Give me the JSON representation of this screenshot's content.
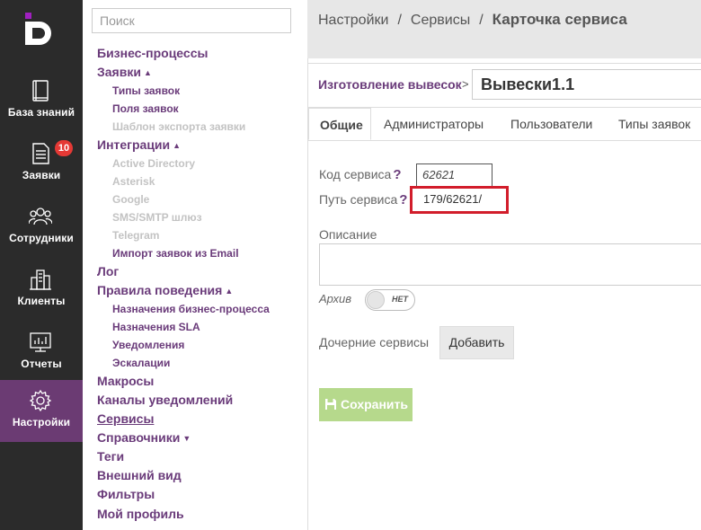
{
  "rail": {
    "items": [
      {
        "label": "База знаний",
        "icon": "book-icon"
      },
      {
        "label": "Заявки",
        "icon": "document-icon",
        "badge": "10"
      },
      {
        "label": "Сотрудники",
        "icon": "people-icon"
      },
      {
        "label": "Клиенты",
        "icon": "buildings-icon"
      },
      {
        "label": "Отчеты",
        "icon": "chart-monitor-icon"
      },
      {
        "label": "Настройки",
        "icon": "gear-icon"
      }
    ],
    "active_index": 5
  },
  "menu": {
    "search_placeholder": "Поиск",
    "items": [
      {
        "label": "Бизнес-процессы"
      },
      {
        "label": "Заявки",
        "expanded": true
      },
      {
        "label": "Типы заявок"
      },
      {
        "label": "Поля заявок"
      },
      {
        "label": "Шаблон экспорта заявки",
        "disabled": true
      },
      {
        "label": "Интеграции",
        "expanded": true
      },
      {
        "label": "Active Directory",
        "disabled": true
      },
      {
        "label": "Asterisk",
        "disabled": true
      },
      {
        "label": "Google",
        "disabled": true
      },
      {
        "label": "SMS/SMTP шлюз",
        "disabled": true
      },
      {
        "label": "Telegram",
        "disabled": true
      },
      {
        "label": "Импорт заявок из Email"
      },
      {
        "label": "Лог"
      },
      {
        "label": "Правила поведения",
        "expanded": true
      },
      {
        "label": "Назначения бизнес-процесса"
      },
      {
        "label": "Назначения SLA"
      },
      {
        "label": "Уведомления"
      },
      {
        "label": "Эскалации"
      },
      {
        "label": "Макросы"
      },
      {
        "label": "Каналы уведомлений"
      },
      {
        "label": "Сервисы",
        "current": true
      },
      {
        "label": "Справочники",
        "expanded": false
      },
      {
        "label": "Теги"
      },
      {
        "label": "Внешний вид"
      },
      {
        "label": "Фильтры"
      },
      {
        "label": "Мой профиль"
      }
    ]
  },
  "breadcrumb": {
    "items": [
      "Настройки",
      "Сервисы",
      "Карточка сервиса"
    ],
    "separator": "/"
  },
  "service": {
    "parent_link": "Изготовление вывесок",
    "chevron": ">",
    "title": "Вывески1.1"
  },
  "tabs": [
    {
      "label": "Общие",
      "active": true
    },
    {
      "label": "Администраторы"
    },
    {
      "label": "Пользователи"
    },
    {
      "label": "Типы заявок"
    }
  ],
  "form": {
    "code_label": "Код сервиса",
    "code_value": "62621",
    "path_label": "Путь сервиса",
    "path_value": "179/62621/",
    "help_mark": "?",
    "description_label": "Описание",
    "description_value": "",
    "archive_label": "Архив",
    "archive_toggle_text": "НЕТ",
    "archive_on": false,
    "children_label": "Дочерние сервисы",
    "add_button": "Добавить",
    "save_button": "Сохранить"
  },
  "colors": {
    "rail_bg": "#2b2b2b",
    "rail_active": "#6b3b73",
    "accent": "#6a3b7a",
    "badge": "#e53935",
    "highlight": "#d21d2b",
    "save_button": "#b6d98c"
  }
}
